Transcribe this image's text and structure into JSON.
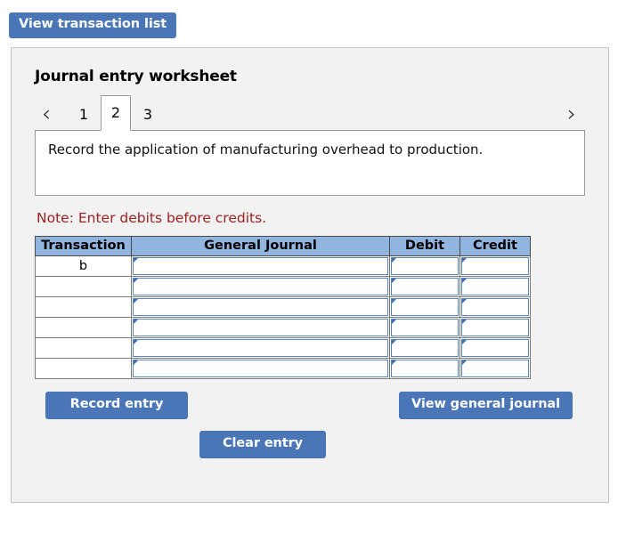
{
  "top": {
    "view_transaction_list_label": "View transaction list"
  },
  "panel": {
    "title": "Journal entry worksheet",
    "nav": {
      "prev_icon": "‹",
      "next_icon": "›"
    },
    "tabs": [
      {
        "label": "1",
        "active": false
      },
      {
        "label": "2",
        "active": true
      },
      {
        "label": "3",
        "active": false
      }
    ],
    "description": "Record the application of manufacturing overhead to production.",
    "note": "Note: Enter debits before credits.",
    "table": {
      "headers": [
        "Transaction",
        "General Journal",
        "Debit",
        "Credit"
      ],
      "rows": [
        {
          "transaction": "b",
          "general_journal": "",
          "debit": "",
          "credit": ""
        },
        {
          "transaction": "",
          "general_journal": "",
          "debit": "",
          "credit": ""
        },
        {
          "transaction": "",
          "general_journal": "",
          "debit": "",
          "credit": ""
        },
        {
          "transaction": "",
          "general_journal": "",
          "debit": "",
          "credit": ""
        },
        {
          "transaction": "",
          "general_journal": "",
          "debit": "",
          "credit": ""
        },
        {
          "transaction": "",
          "general_journal": "",
          "debit": "",
          "credit": ""
        }
      ]
    },
    "buttons": {
      "record_entry": "Record entry",
      "clear_entry": "Clear entry",
      "view_general_journal": "View general journal"
    }
  },
  "colors": {
    "button_blue": "#4a76b8",
    "table_header_blue": "#92b5e0",
    "note_red": "#a02020",
    "panel_bg": "#f2f2f2",
    "input_border_blue": "#5b84bd"
  }
}
